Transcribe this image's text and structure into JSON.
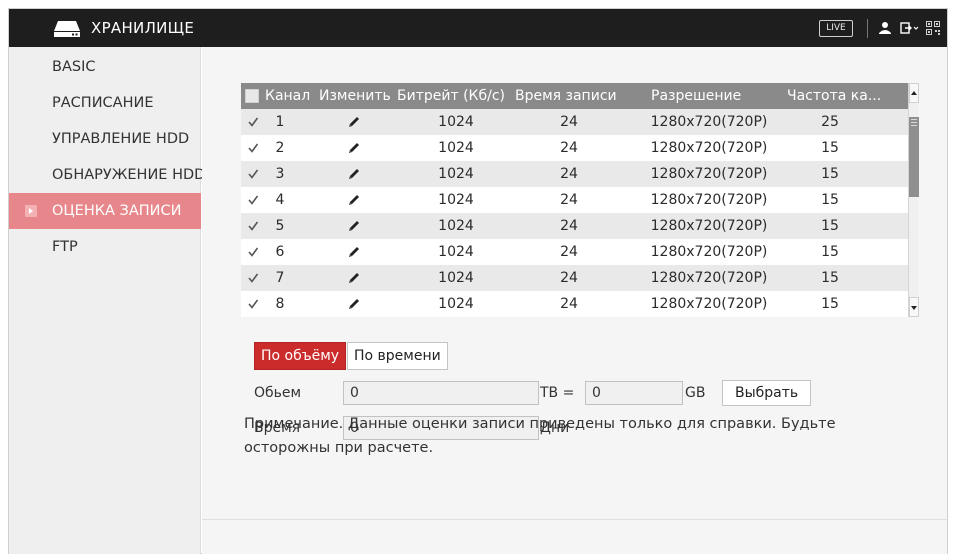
{
  "header": {
    "title": "ХРАНИЛИЩЕ",
    "live_label": "LIVE",
    "icons": [
      "storage-icon",
      "user-icon",
      "logout-icon",
      "qr-icon"
    ]
  },
  "sidebar": {
    "items": [
      {
        "label": "BASIC",
        "active": false
      },
      {
        "label": "РАСПИСАНИЕ",
        "active": false
      },
      {
        "label": "УПРАВЛЕНИЕ HDD",
        "active": false
      },
      {
        "label": "ОБНАРУЖЕНИЕ HDD",
        "active": false
      },
      {
        "label": "ОЦЕНКА ЗАПИСИ",
        "active": true
      },
      {
        "label": "FTP",
        "active": false
      }
    ]
  },
  "table": {
    "columns": [
      "Канал",
      "Изменить",
      "Битрейт (Кб/с)",
      "Время записи",
      "Разрешение",
      "Частота ка..."
    ],
    "rows": [
      {
        "channel": "1",
        "bitrate": "1024",
        "rec_time": "24",
        "resolution": "1280x720(720P)",
        "fps": "25",
        "checked": true
      },
      {
        "channel": "2",
        "bitrate": "1024",
        "rec_time": "24",
        "resolution": "1280x720(720P)",
        "fps": "15",
        "checked": true
      },
      {
        "channel": "3",
        "bitrate": "1024",
        "rec_time": "24",
        "resolution": "1280x720(720P)",
        "fps": "15",
        "checked": true
      },
      {
        "channel": "4",
        "bitrate": "1024",
        "rec_time": "24",
        "resolution": "1280x720(720P)",
        "fps": "15",
        "checked": true
      },
      {
        "channel": "5",
        "bitrate": "1024",
        "rec_time": "24",
        "resolution": "1280x720(720P)",
        "fps": "15",
        "checked": true
      },
      {
        "channel": "6",
        "bitrate": "1024",
        "rec_time": "24",
        "resolution": "1280x720(720P)",
        "fps": "15",
        "checked": true
      },
      {
        "channel": "7",
        "bitrate": "1024",
        "rec_time": "24",
        "resolution": "1280x720(720P)",
        "fps": "15",
        "checked": true
      },
      {
        "channel": "8",
        "bitrate": "1024",
        "rec_time": "24",
        "resolution": "1280x720(720P)",
        "fps": "15",
        "checked": true
      }
    ]
  },
  "modes": {
    "by_volume": "По объёму",
    "by_time": "По времени",
    "active": "by_volume"
  },
  "form": {
    "volume_label": "Обьем",
    "volume_value": "0",
    "tb_label": "TB =",
    "gb_value": "0",
    "gb_label": "GB",
    "pick_button": "Выбрать",
    "time_label": "Время",
    "time_value": "0",
    "days_label": "Дни"
  },
  "note": "Примечание. Данные оценки записи приведены только для справки. Будьте осторожны при расчете.",
  "colors": {
    "topbar": "#1e1e1e",
    "active_sidebar": "#e7878c",
    "active_button": "#cc2b2b",
    "table_header": "#8a8a8a"
  }
}
